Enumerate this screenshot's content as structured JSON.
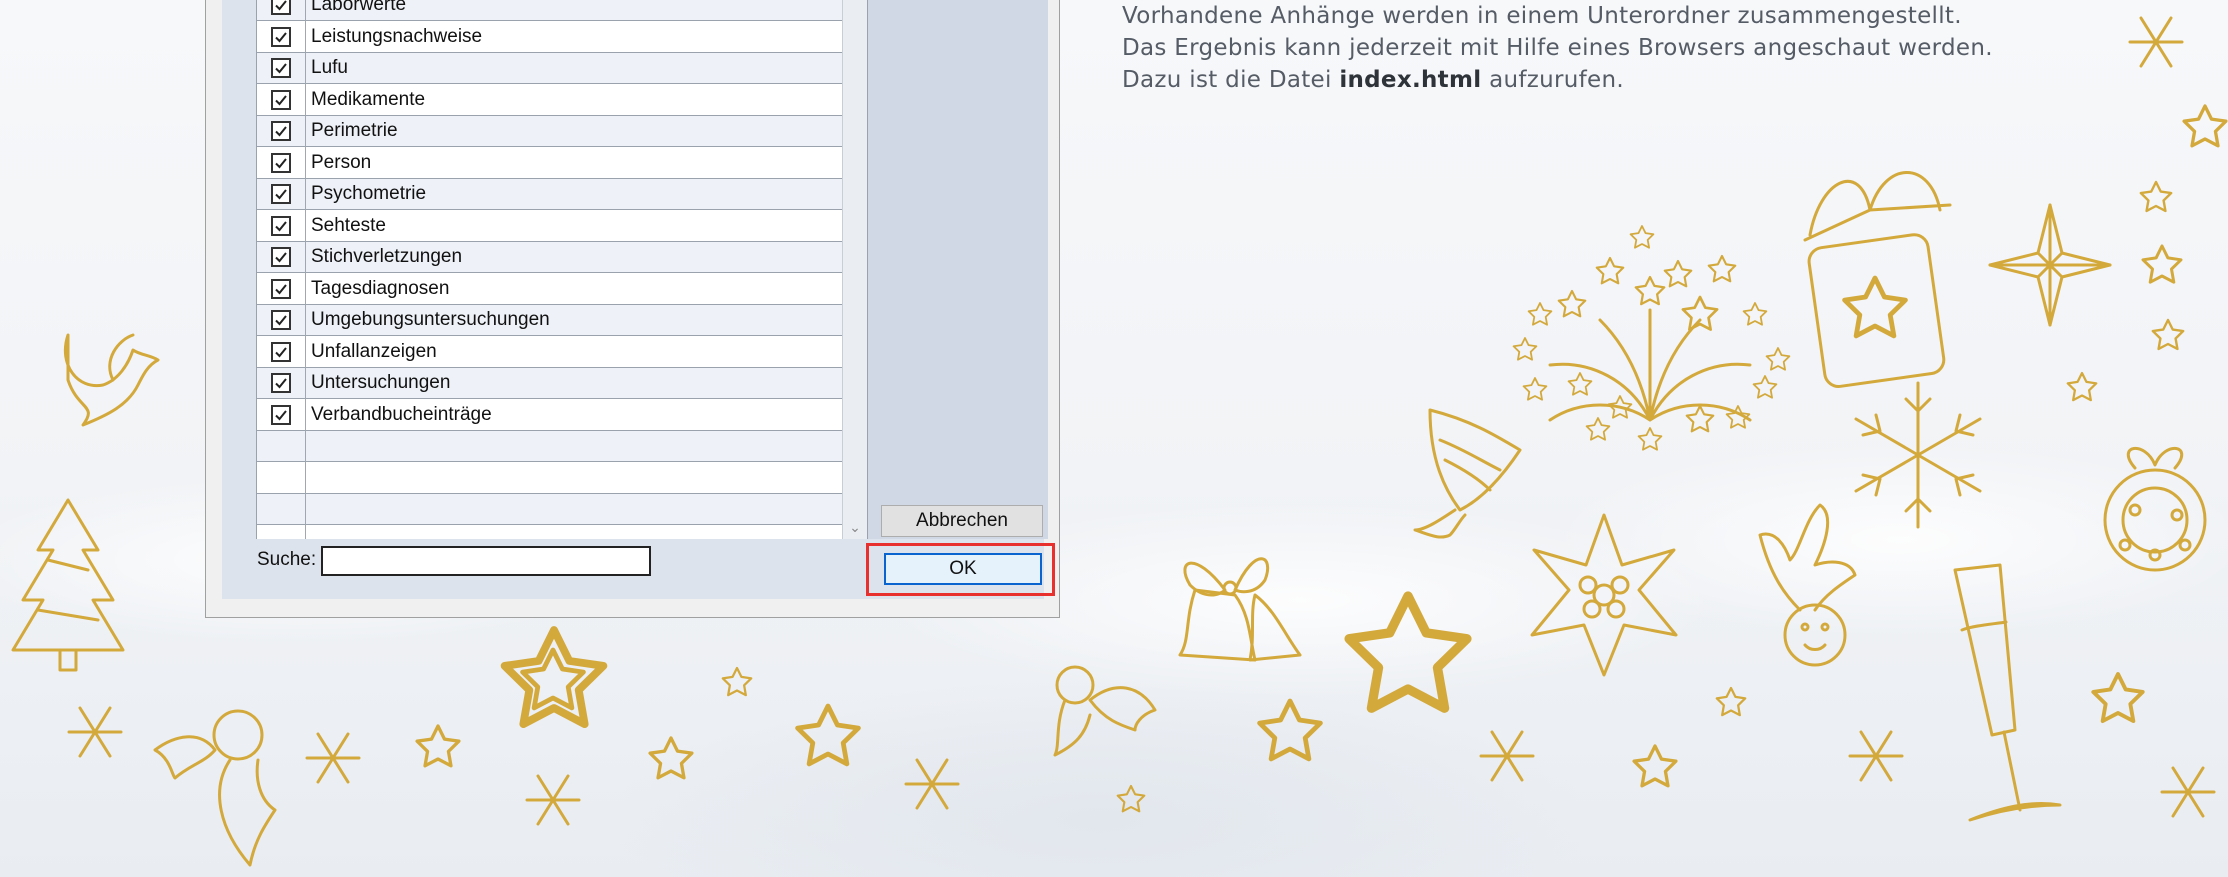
{
  "dialog": {
    "list_items": [
      "Laborwerte",
      "Leistungsnachweise",
      "Lufu",
      "Medikamente",
      "Perimetrie",
      "Person",
      "Psychometrie",
      "Sehteste",
      "Stichverletzungen",
      "Tagesdiagnosen",
      "Umgebungsuntersuchungen",
      "Unfallanzeigen",
      "Untersuchungen",
      "Verbandbucheinträge"
    ],
    "cancel_label": "Abbrechen",
    "ok_label": "OK",
    "search_label": "Suche:",
    "search_value": ""
  },
  "description": {
    "line1": "Vorhandene Anhänge werden in einem Unterordner zusammengestellt.",
    "line2": "Das Ergebnis kann jederzeit mit Hilfe eines Browsers angeschaut werden.",
    "line3_prefix": "Dazu ist die Datei",
    "line3_bold": "index.html",
    "line3_suffix": "aufzurufen."
  },
  "colors": {
    "gold": "#d4a93c",
    "highlight_red": "#e8302f",
    "ok_border": "#0a64d0"
  }
}
